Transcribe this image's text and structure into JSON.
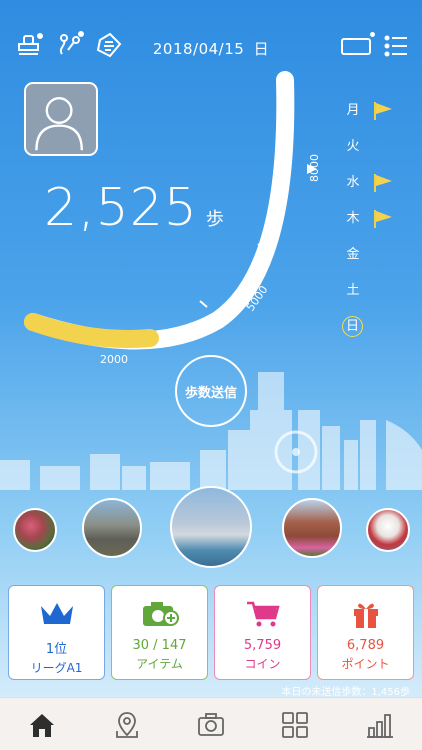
{
  "header": {
    "date": "2018/04/15",
    "weekday": "日",
    "icons": [
      "stamp-icon",
      "route-icon",
      "document-icon",
      "battery-icon",
      "menu-icon"
    ]
  },
  "steps": {
    "count": "2,525",
    "unit": "歩",
    "progress_goal": 8000,
    "progress_value": 2525
  },
  "gauge": {
    "ticks": [
      "2000",
      "5000",
      "8000"
    ]
  },
  "weekdays": [
    {
      "label": "月",
      "flag": true
    },
    {
      "label": "火",
      "flag": false
    },
    {
      "label": "水",
      "flag": true
    },
    {
      "label": "木",
      "flag": true
    },
    {
      "label": "金",
      "flag": false
    },
    {
      "label": "土",
      "flag": false
    },
    {
      "label": "日",
      "flag": false,
      "today": true
    }
  ],
  "send_button": {
    "label": "歩数送信"
  },
  "photos": [
    {
      "name": "flower-garden"
    },
    {
      "name": "elephant"
    },
    {
      "name": "yokohama-ferris-wheel"
    },
    {
      "name": "brick-building"
    },
    {
      "name": "festival-booth"
    }
  ],
  "stats": [
    {
      "icon": "crown-icon",
      "line1": "1位",
      "line2": "リーグA1",
      "color": "#1f68d2"
    },
    {
      "icon": "camera-plus-icon",
      "line1": "30 / 147",
      "line2": "アイテム",
      "color": "#62a73b"
    },
    {
      "icon": "cart-icon",
      "line1": "5,759",
      "line2": "コイン",
      "color": "#e0398a"
    },
    {
      "icon": "gift-icon",
      "line1": "6,789",
      "line2": "ポイント",
      "color": "#e8543f"
    }
  ],
  "unsent_text": "本日の未送信歩数：1,456歩",
  "nav": [
    {
      "icon": "home-icon",
      "active": true
    },
    {
      "icon": "map-pin-icon"
    },
    {
      "icon": "camera-icon"
    },
    {
      "icon": "grid-icon"
    },
    {
      "icon": "bar-chart-icon"
    }
  ]
}
